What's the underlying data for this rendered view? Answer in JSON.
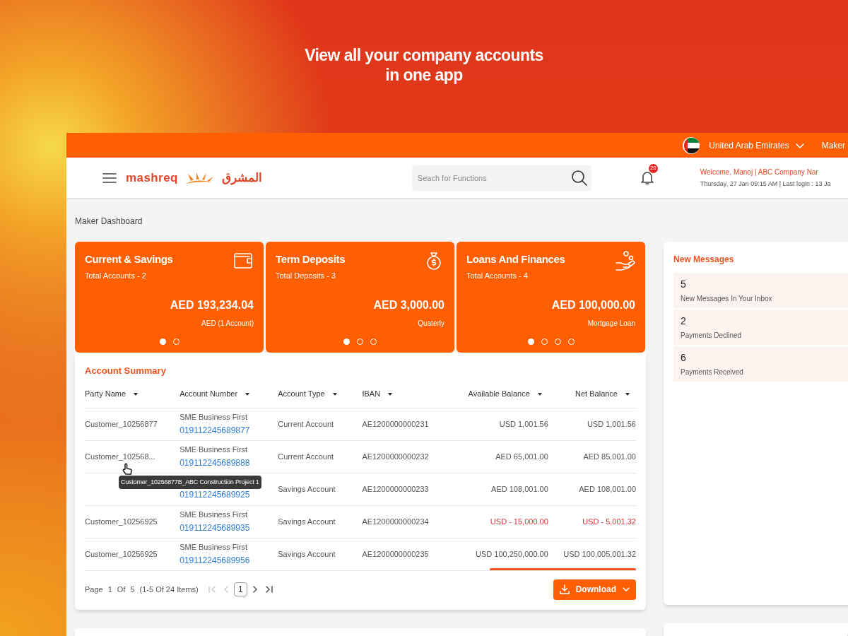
{
  "headline": [
    "View all your company accounts",
    "in one app"
  ],
  "top_bar": {
    "country": "United Arab Emirates",
    "role": "Maker"
  },
  "header": {
    "logo": "mashreq",
    "logo_arabic": "المشرق",
    "search": {
      "placeholder": "Seach for Functions"
    },
    "notification_badge": "20",
    "welcome": "Welcome, Manoj | ABC Company Nar",
    "last_login": "Thursday, 27 Jan 09:15 AM | Last login : 13 Ja"
  },
  "breadcrumb": "Maker Dashboard",
  "summary_cards": [
    {
      "title": "Current & Savings",
      "subtitle": "Total Accounts - 2",
      "amount": "AED 193,234.04",
      "note": "AED (1 Account)",
      "dots": [
        {
          "selected": true
        },
        {
          "selected": false
        }
      ]
    },
    {
      "title": "Term Deposits",
      "subtitle": "Total Deposits - 3",
      "amount": "AED 3,000.00",
      "note": "Quaterly",
      "dots": [
        {
          "selected": true
        },
        {
          "selected": false
        },
        {
          "selected": false
        }
      ]
    },
    {
      "title": "Loans And Finances",
      "subtitle": "Total Accounts - 4",
      "amount": "AED 100,000.00",
      "note": "Mortgage Loan",
      "dots": [
        {
          "selected": true
        },
        {
          "selected": false
        },
        {
          "selected": false
        },
        {
          "selected": false
        }
      ]
    }
  ],
  "account_summary": {
    "title": "Account Summary",
    "columns": [
      "Party Name",
      "Account Number",
      "Account Type",
      "IBAN",
      "Available Balance",
      "Net Balance"
    ],
    "rows": [
      {
        "party_name": "Customer_10256877",
        "product": "SME Business First",
        "account_number": "019112245689877",
        "account_type": "Current Account",
        "iban": "AE1200000000231",
        "available_balance": "USD 1,001.56",
        "net_balance": "USD 1,001.56",
        "negative": false
      },
      {
        "party_name": "Customer_102568...",
        "product": "SME Business First",
        "account_number": "019112245689888",
        "account_type": "Current Account",
        "iban": "AE1200000000232",
        "available_balance": "AED 65,001.00",
        "net_balance": "AED 85,001.00",
        "negative": false
      },
      {
        "account_number": "019112245689925",
        "account_type": "Savings Account",
        "iban": "AE1200000000233",
        "available_balance": "AED 108,001.00",
        "net_balance": "AED 108,001.00",
        "negative": false
      },
      {
        "party_name": "Customer_10256925",
        "product": "SME Business First",
        "account_number": "019112245689935",
        "account_type": "Savings Account",
        "iban": "AE1200000000234",
        "available_balance": "USD - 15,000.00",
        "net_balance": "USD - 5,001.32",
        "negative": true
      },
      {
        "party_name": "Customer_10256925",
        "product": "SME Business First",
        "account_number": "019112245689956",
        "account_type": "Savings Account",
        "iban": "AE1200000000235",
        "available_balance": "USD 100,250,000.00",
        "net_balance": "USD 100,005,001.32",
        "negative": false
      }
    ],
    "tooltip": "Customer_10256877B_ABC Construction Project 1",
    "pagination": {
      "page_label": "Page",
      "page": "1",
      "of_label": "Of",
      "total_pages": "5",
      "range": "(1-5 Of 24 Items)",
      "current": "1"
    },
    "download_button": "Download"
  },
  "new_messages": {
    "title": "New Messages",
    "items": [
      {
        "count": "5",
        "label": "New Messages In Your Inbox"
      },
      {
        "count": "2",
        "label": "Payments Declined"
      },
      {
        "count": "6",
        "label": "Payments Received"
      }
    ]
  }
}
